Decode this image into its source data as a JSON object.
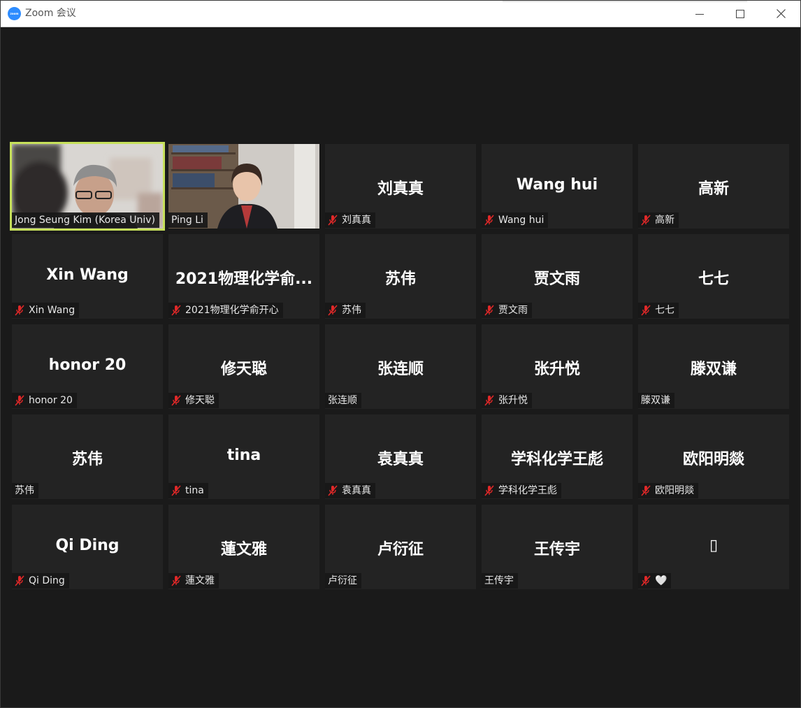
{
  "window": {
    "title": "Zoom 会议",
    "logo_text": "zoom",
    "accent": "#2d8cff"
  },
  "participants": [
    {
      "tile_name": "",
      "label": "Jong Seung Kim (Korea Univ)",
      "muted": false,
      "video": true,
      "active_speaker": true
    },
    {
      "tile_name": "",
      "label": "Ping Li",
      "muted": false,
      "video": true,
      "active_speaker": false
    },
    {
      "tile_name": "刘真真",
      "label": "刘真真",
      "muted": true
    },
    {
      "tile_name": "Wang hui",
      "label": "Wang hui",
      "muted": true
    },
    {
      "tile_name": "高新",
      "label": "高新",
      "muted": true
    },
    {
      "tile_name": "Xin Wang",
      "label": "Xin Wang",
      "muted": true
    },
    {
      "tile_name": "2021物理化学俞...",
      "label": "2021物理化学俞开心",
      "muted": true
    },
    {
      "tile_name": "苏伟",
      "label": "苏伟",
      "muted": true
    },
    {
      "tile_name": "贾文雨",
      "label": "贾文雨",
      "muted": true
    },
    {
      "tile_name": "七七",
      "label": "七七",
      "muted": true
    },
    {
      "tile_name": "honor 20",
      "label": "honor 20",
      "muted": true
    },
    {
      "tile_name": "修天聪",
      "label": "修天聪",
      "muted": true
    },
    {
      "tile_name": "张连顺",
      "label": "张连顺",
      "muted": false
    },
    {
      "tile_name": "张升悦",
      "label": "张升悦",
      "muted": true
    },
    {
      "tile_name": "滕双谦",
      "label": "滕双谦",
      "muted": false
    },
    {
      "tile_name": "苏伟",
      "label": "苏伟",
      "muted": false
    },
    {
      "tile_name": "tina",
      "label": "tina",
      "muted": true
    },
    {
      "tile_name": "袁真真",
      "label": "袁真真",
      "muted": true
    },
    {
      "tile_name": "学科化学王彪",
      "label": "学科化学王彪",
      "muted": true
    },
    {
      "tile_name": "欧阳明燚",
      "label": "欧阳明燚",
      "muted": true
    },
    {
      "tile_name": "Qi Ding",
      "label": "Qi Ding",
      "muted": true
    },
    {
      "tile_name": "蓮文雅",
      "label": "蓮文雅",
      "muted": true
    },
    {
      "tile_name": "卢衍征",
      "label": "卢衍征",
      "muted": false
    },
    {
      "tile_name": "王传宇",
      "label": "王传宇",
      "muted": false
    },
    {
      "tile_name": "▯",
      "label": "🤍",
      "muted": true
    }
  ],
  "colors": {
    "active_speaker_border": "#c6e05a",
    "muted_icon": "#e02828",
    "tile_bg": "#232323"
  }
}
